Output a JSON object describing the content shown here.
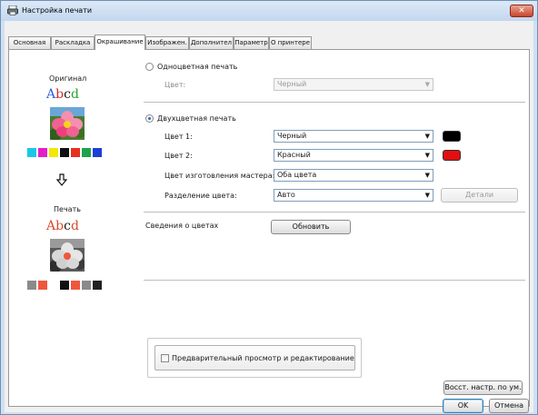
{
  "window": {
    "title": "Настройка печати"
  },
  "tabs": [
    {
      "label": "Основная"
    },
    {
      "label": "Раскладка"
    },
    {
      "label": "Окрашивание"
    },
    {
      "label": "Изображен."
    },
    {
      "label": "Дополнител"
    },
    {
      "label": "Параметр"
    },
    {
      "label": "О принтере"
    }
  ],
  "active_tab": "Окрашивание",
  "preview": {
    "original_label": "Оригинал",
    "print_label": "Печать",
    "sample_text": "Abcd",
    "original_sample_colors": [
      "#2e5fd6",
      "#d42b2b",
      "#1a1a1a",
      "#2aa52a"
    ],
    "print_sample_colors": [
      "#d94a2b",
      "#d94a2b",
      "#1a1a1a",
      "#d94a2b"
    ],
    "original_swatches": [
      "#19c8e6",
      "#e51ec8",
      "#f2e800",
      "#111111",
      "#e8301e",
      "#1ea24a",
      "#1e3ed6"
    ],
    "print_swatches": [
      "#8a8a8a",
      "#f0563c",
      "#ffffff",
      "#111111",
      "#f0563c",
      "#8a8a8a",
      "#222222"
    ]
  },
  "mono": {
    "label": "Одноцветная печать",
    "color_label": "Цвет:",
    "color_value": "Черный"
  },
  "duo": {
    "label": "Двухцветная печать",
    "color1_label": "Цвет 1:",
    "color1_value": "Черный",
    "color1_chip": "#000000",
    "color2_label": "Цвет 2:",
    "color2_value": "Красный",
    "color2_chip": "#e01010",
    "master_label": "Цвет изготовления мастера:",
    "master_value": "Оба цвета",
    "separation_label": "Разделение цвета:",
    "separation_value": "Авто",
    "details_button": "Детали"
  },
  "color_info": {
    "label": "Сведения о цветах",
    "refresh_button": "Обновить"
  },
  "preview_edit": {
    "label": "Предварительный просмотр и редактирование"
  },
  "buttons": {
    "restore_defaults": "Восст. настр. по ум.",
    "ok": "OK",
    "cancel": "Отмена"
  }
}
